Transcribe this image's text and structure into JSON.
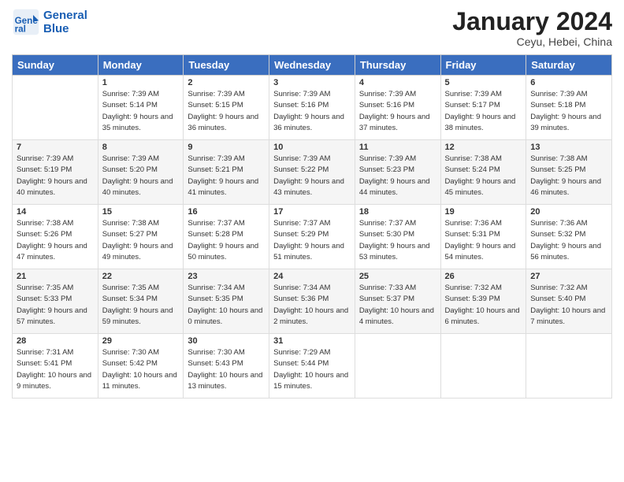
{
  "header": {
    "logo_line1": "General",
    "logo_line2": "Blue",
    "month": "January 2024",
    "location": "Ceyu, Hebei, China"
  },
  "days_of_week": [
    "Sunday",
    "Monday",
    "Tuesday",
    "Wednesday",
    "Thursday",
    "Friday",
    "Saturday"
  ],
  "weeks": [
    [
      {
        "day": "",
        "sunrise": "",
        "sunset": "",
        "daylight": ""
      },
      {
        "day": "1",
        "sunrise": "Sunrise: 7:39 AM",
        "sunset": "Sunset: 5:14 PM",
        "daylight": "Daylight: 9 hours and 35 minutes."
      },
      {
        "day": "2",
        "sunrise": "Sunrise: 7:39 AM",
        "sunset": "Sunset: 5:15 PM",
        "daylight": "Daylight: 9 hours and 36 minutes."
      },
      {
        "day": "3",
        "sunrise": "Sunrise: 7:39 AM",
        "sunset": "Sunset: 5:16 PM",
        "daylight": "Daylight: 9 hours and 36 minutes."
      },
      {
        "day": "4",
        "sunrise": "Sunrise: 7:39 AM",
        "sunset": "Sunset: 5:16 PM",
        "daylight": "Daylight: 9 hours and 37 minutes."
      },
      {
        "day": "5",
        "sunrise": "Sunrise: 7:39 AM",
        "sunset": "Sunset: 5:17 PM",
        "daylight": "Daylight: 9 hours and 38 minutes."
      },
      {
        "day": "6",
        "sunrise": "Sunrise: 7:39 AM",
        "sunset": "Sunset: 5:18 PM",
        "daylight": "Daylight: 9 hours and 39 minutes."
      }
    ],
    [
      {
        "day": "7",
        "sunrise": "Sunrise: 7:39 AM",
        "sunset": "Sunset: 5:19 PM",
        "daylight": "Daylight: 9 hours and 40 minutes."
      },
      {
        "day": "8",
        "sunrise": "Sunrise: 7:39 AM",
        "sunset": "Sunset: 5:20 PM",
        "daylight": "Daylight: 9 hours and 40 minutes."
      },
      {
        "day": "9",
        "sunrise": "Sunrise: 7:39 AM",
        "sunset": "Sunset: 5:21 PM",
        "daylight": "Daylight: 9 hours and 41 minutes."
      },
      {
        "day": "10",
        "sunrise": "Sunrise: 7:39 AM",
        "sunset": "Sunset: 5:22 PM",
        "daylight": "Daylight: 9 hours and 43 minutes."
      },
      {
        "day": "11",
        "sunrise": "Sunrise: 7:39 AM",
        "sunset": "Sunset: 5:23 PM",
        "daylight": "Daylight: 9 hours and 44 minutes."
      },
      {
        "day": "12",
        "sunrise": "Sunrise: 7:38 AM",
        "sunset": "Sunset: 5:24 PM",
        "daylight": "Daylight: 9 hours and 45 minutes."
      },
      {
        "day": "13",
        "sunrise": "Sunrise: 7:38 AM",
        "sunset": "Sunset: 5:25 PM",
        "daylight": "Daylight: 9 hours and 46 minutes."
      }
    ],
    [
      {
        "day": "14",
        "sunrise": "Sunrise: 7:38 AM",
        "sunset": "Sunset: 5:26 PM",
        "daylight": "Daylight: 9 hours and 47 minutes."
      },
      {
        "day": "15",
        "sunrise": "Sunrise: 7:38 AM",
        "sunset": "Sunset: 5:27 PM",
        "daylight": "Daylight: 9 hours and 49 minutes."
      },
      {
        "day": "16",
        "sunrise": "Sunrise: 7:37 AM",
        "sunset": "Sunset: 5:28 PM",
        "daylight": "Daylight: 9 hours and 50 minutes."
      },
      {
        "day": "17",
        "sunrise": "Sunrise: 7:37 AM",
        "sunset": "Sunset: 5:29 PM",
        "daylight": "Daylight: 9 hours and 51 minutes."
      },
      {
        "day": "18",
        "sunrise": "Sunrise: 7:37 AM",
        "sunset": "Sunset: 5:30 PM",
        "daylight": "Daylight: 9 hours and 53 minutes."
      },
      {
        "day": "19",
        "sunrise": "Sunrise: 7:36 AM",
        "sunset": "Sunset: 5:31 PM",
        "daylight": "Daylight: 9 hours and 54 minutes."
      },
      {
        "day": "20",
        "sunrise": "Sunrise: 7:36 AM",
        "sunset": "Sunset: 5:32 PM",
        "daylight": "Daylight: 9 hours and 56 minutes."
      }
    ],
    [
      {
        "day": "21",
        "sunrise": "Sunrise: 7:35 AM",
        "sunset": "Sunset: 5:33 PM",
        "daylight": "Daylight: 9 hours and 57 minutes."
      },
      {
        "day": "22",
        "sunrise": "Sunrise: 7:35 AM",
        "sunset": "Sunset: 5:34 PM",
        "daylight": "Daylight: 9 hours and 59 minutes."
      },
      {
        "day": "23",
        "sunrise": "Sunrise: 7:34 AM",
        "sunset": "Sunset: 5:35 PM",
        "daylight": "Daylight: 10 hours and 0 minutes."
      },
      {
        "day": "24",
        "sunrise": "Sunrise: 7:34 AM",
        "sunset": "Sunset: 5:36 PM",
        "daylight": "Daylight: 10 hours and 2 minutes."
      },
      {
        "day": "25",
        "sunrise": "Sunrise: 7:33 AM",
        "sunset": "Sunset: 5:37 PM",
        "daylight": "Daylight: 10 hours and 4 minutes."
      },
      {
        "day": "26",
        "sunrise": "Sunrise: 7:32 AM",
        "sunset": "Sunset: 5:39 PM",
        "daylight": "Daylight: 10 hours and 6 minutes."
      },
      {
        "day": "27",
        "sunrise": "Sunrise: 7:32 AM",
        "sunset": "Sunset: 5:40 PM",
        "daylight": "Daylight: 10 hours and 7 minutes."
      }
    ],
    [
      {
        "day": "28",
        "sunrise": "Sunrise: 7:31 AM",
        "sunset": "Sunset: 5:41 PM",
        "daylight": "Daylight: 10 hours and 9 minutes."
      },
      {
        "day": "29",
        "sunrise": "Sunrise: 7:30 AM",
        "sunset": "Sunset: 5:42 PM",
        "daylight": "Daylight: 10 hours and 11 minutes."
      },
      {
        "day": "30",
        "sunrise": "Sunrise: 7:30 AM",
        "sunset": "Sunset: 5:43 PM",
        "daylight": "Daylight: 10 hours and 13 minutes."
      },
      {
        "day": "31",
        "sunrise": "Sunrise: 7:29 AM",
        "sunset": "Sunset: 5:44 PM",
        "daylight": "Daylight: 10 hours and 15 minutes."
      },
      {
        "day": "",
        "sunrise": "",
        "sunset": "",
        "daylight": ""
      },
      {
        "day": "",
        "sunrise": "",
        "sunset": "",
        "daylight": ""
      },
      {
        "day": "",
        "sunrise": "",
        "sunset": "",
        "daylight": ""
      }
    ]
  ]
}
